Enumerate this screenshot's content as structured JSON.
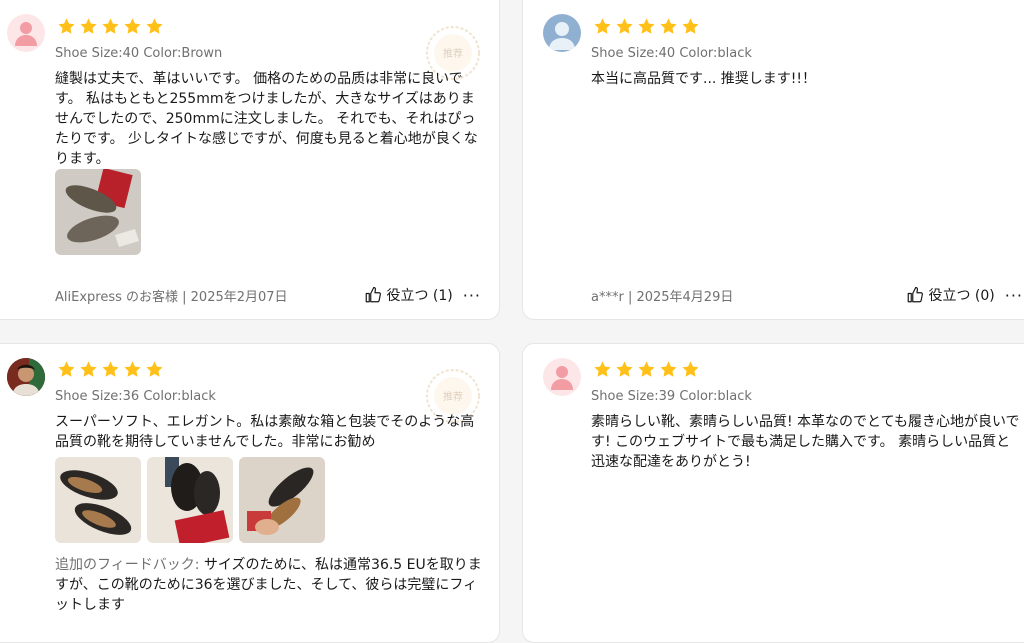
{
  "reviews": [
    {
      "rating": 5,
      "sku": "Shoe Size:40 Color:Brown",
      "text": "縫製は丈夫で、革はいいです。 価格のための品质は非常に良いです。 私はもともと255mmをつけましたが、大きなサイズはありませんでしたので、250mmに注文しました。 それでも、それはぴったりです。 少しタイトな感じですが、何度も見ると着心地が良くなります。",
      "meta": "AliExpress のお客様 | 2025年2月07日",
      "helpful": "役立つ (1)",
      "badge": "推荐"
    },
    {
      "rating": 5,
      "sku": "Shoe Size:40 Color:black",
      "text": "本当に高品質です... 推奨します!!！",
      "meta": "a***r | 2025年4月29日",
      "helpful": "役立つ (0)"
    },
    {
      "rating": 5,
      "sku": "Shoe Size:36 Color:black",
      "text": "スーパーソフト、エレガント。私は素敵な箱と包装でそのような高品質の靴を期待していませんでした。非常にお勧め",
      "feedback_label": "追加のフィードバック:",
      "feedback_text": " サイズのために、私は通常36.5 EUを取りますが、この靴のために36を選びました、そして、彼らは完璧にフィットします",
      "badge": "推荐"
    },
    {
      "rating": 5,
      "sku": "Shoe Size:39 Color:black",
      "text": "素晴らしい靴、素晴らしい品質! 本革なのでとても履き心地が良いです! このウェブサイトで最も満足した購入です。 素晴らしい品質と迅速な配達をありがとう!"
    }
  ],
  "more_icon": "···",
  "colors": {
    "star": "#ffc119",
    "text": "#191919",
    "muted": "#707070"
  }
}
